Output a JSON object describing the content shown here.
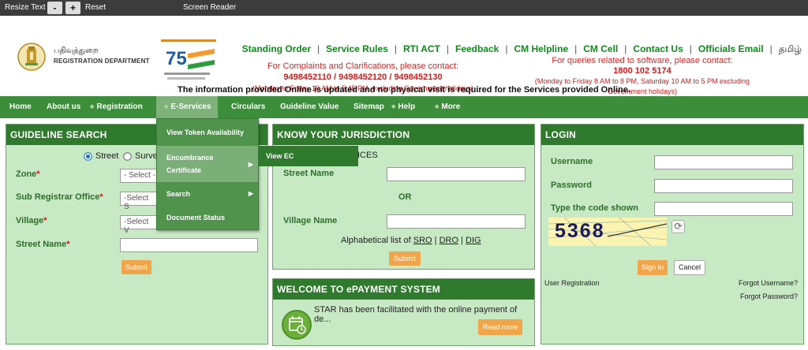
{
  "accessibility": {
    "resize_text": "Resize Text",
    "minus": "-",
    "plus": "+",
    "reset": "Reset",
    "screen_reader": "Screen Reader"
  },
  "header": {
    "dept_tamil": "பதிவுத்துறை",
    "dept_english": "REGISTRATION DEPARTMENT",
    "top_links": [
      "Standing Order",
      "Service Rules",
      "RTI ACT",
      "Feedback",
      "CM Helpline",
      "CM Cell",
      "Contact Us",
      "Officials Email",
      "தமிழ்"
    ],
    "complaints": {
      "title": "For Complaints and Clarifications, please contact:",
      "phones": "9498452110 / 9498452120 / 9498452130",
      "hours": "(Monday to Friday 10 AM to 5.45 PM, excluding Government holidays)"
    },
    "software": {
      "title": "For queries related to software, please contact:",
      "phone": "1800 102 5174",
      "hours": "(Monday to Friday 8 AM to 8 PM, Saturday 10 AM to 5 PM excluding Government holidays)"
    },
    "notice": "The information provided Online is updated and no physical visit is required for the Services provided Online."
  },
  "nav": {
    "items": [
      "Home",
      "About us",
      "Registration",
      "E-Services",
      "Circulars",
      "Guideline Value",
      "Sitemap",
      "Help",
      "More"
    ],
    "dropdown": [
      "View Token Availability",
      "Encumbrance",
      "Certificate",
      "Search",
      "Document Status"
    ],
    "submenu": "View EC"
  },
  "guideline": {
    "title": "GUIDELINE SEARCH",
    "radio_street": "Street",
    "radio_survey": "Surve",
    "zone_label": "Zone",
    "zone_value": "- Select -",
    "sro_label": "Sub Registrar Office",
    "sro_value": "-Select S",
    "village_label": "Village",
    "village_value": "-Select V",
    "street_label": "Street Name",
    "submit": "Submit",
    "required": "*"
  },
  "jurisdiction": {
    "title": "KNOW YOUR JURISDICTION",
    "subtitle_partial": "ICES",
    "street_label": "Street Name",
    "or": "OR",
    "village_label": "Village Name",
    "alpha_prefix": "Alphabetical list of",
    "links": [
      "SRO",
      "DRO",
      "DIG"
    ],
    "divider": "|",
    "submit": "Submit"
  },
  "epayment": {
    "title": "WELCOME TO ePAYMENT SYSTEM",
    "text": "STAR has been facilitated with the online payment of de...",
    "read_more": "Read more"
  },
  "login": {
    "title": "LOGIN",
    "username_label": "Username",
    "password_label": "Password",
    "captcha_label": "Type the code shown",
    "captcha_text": "5368",
    "signin": "Sign In",
    "cancel": "Cancel",
    "user_registration": "User Registration",
    "forgot_username": "Forgot Username?",
    "forgot_password": "Forgot Password?"
  },
  "colors": {
    "nav_green": "#3d8e3b",
    "panel_green": "#c7e9c4",
    "header_green": "#2f7a2d",
    "link_green": "#118a1e",
    "contact_red": "#d01c1c",
    "button_orange": "#f0a54a"
  }
}
